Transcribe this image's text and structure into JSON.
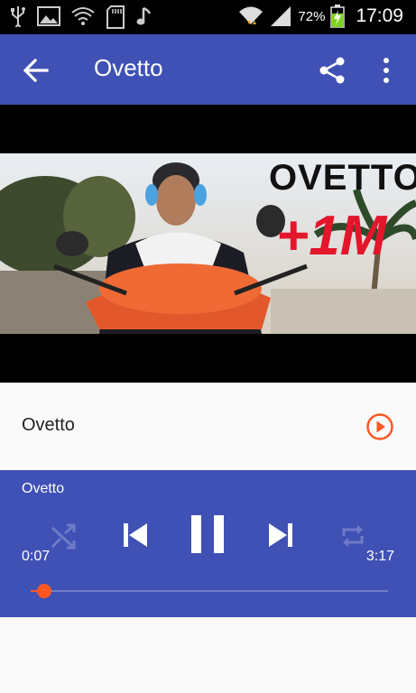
{
  "status_bar": {
    "battery_text": "72%",
    "time": "17:09",
    "battery_level": 0.72,
    "icons": [
      "usb-icon",
      "image-icon",
      "wifi-question-icon",
      "sd-card-icon",
      "music-note-icon",
      "wifi-icon",
      "signal-icon",
      "battery-charging-icon"
    ]
  },
  "app_bar": {
    "title": "Ovetto",
    "icons": [
      "back-arrow-icon",
      "share-icon",
      "more-vert-icon"
    ],
    "color": "#3f51b5"
  },
  "video": {
    "thumb_title": "OVETTO",
    "thumb_badge": "+1M"
  },
  "list": {
    "items": [
      {
        "label": "Ovetto",
        "icon": "play-circle-icon"
      }
    ],
    "accent": "#ff5722"
  },
  "player": {
    "track_title": "Ovetto",
    "elapsed": "0:07",
    "total": "3:17",
    "progress": 0.037,
    "controls": [
      "shuffle-icon",
      "skip-previous-icon",
      "pause-icon",
      "skip-next-icon",
      "repeat-icon"
    ]
  }
}
